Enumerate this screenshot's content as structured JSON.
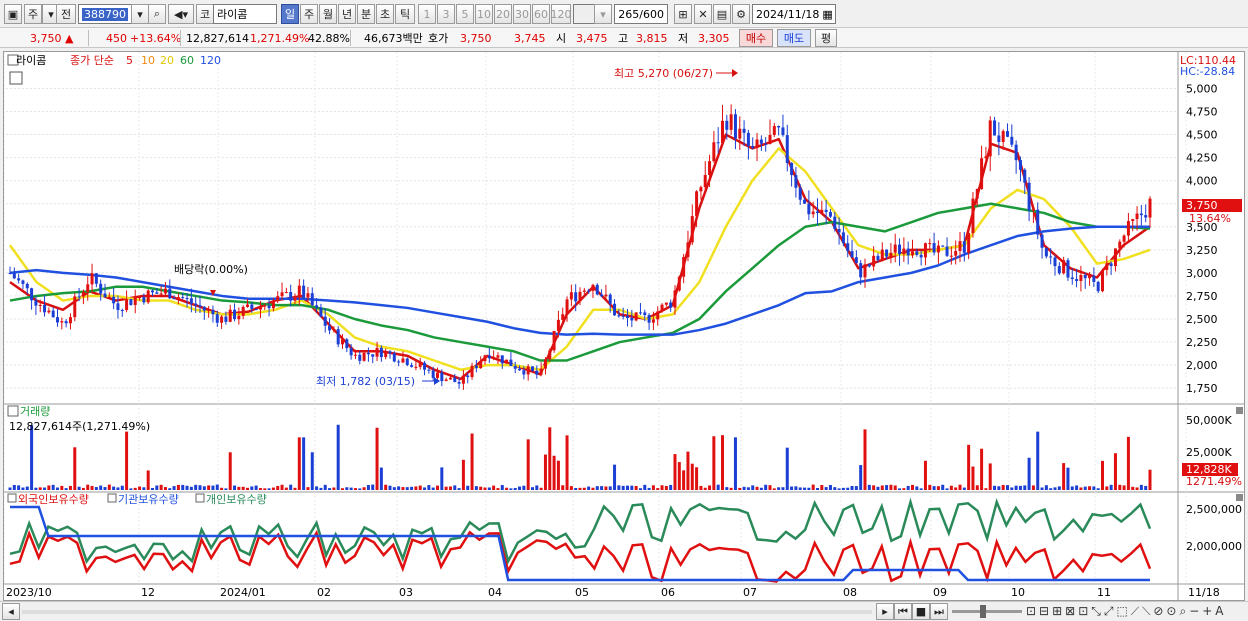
{
  "toolbar": {
    "market_label": "주",
    "prefix_label": "전",
    "code_value": "388790",
    "name_prefix": "코",
    "stock_name": "라이콤",
    "periods": [
      "일",
      "주",
      "월",
      "년",
      "분",
      "초",
      "틱"
    ],
    "selected_period": "일",
    "intervals": [
      "1",
      "3",
      "5",
      "10",
      "20",
      "30",
      "60",
      "120"
    ],
    "count_value": "265",
    "count_total": "/600",
    "date_value": "2024/11/18"
  },
  "quote": {
    "price": "3,750",
    "change_arrow": "▲",
    "change": "450",
    "change_pct": "+13.64%",
    "volume": "12,827,614",
    "volume_ratio": "1,271.49%",
    "turnover": "42.88%",
    "trade_value": "46,673백만",
    "bid_label": "호가",
    "ask_price": "3,750",
    "bid_price": "3,745",
    "open_label": "시",
    "open": "3,475",
    "high_label": "고",
    "high": "3,815",
    "low_label": "저",
    "low": "3,305",
    "buy_label": "매수",
    "sell_label": "매도",
    "eval_label": "평"
  },
  "price_panel": {
    "legend_name": "라이콤",
    "legend_ma_prefix": "종가 단순",
    "ma_periods": [
      "5",
      "10",
      "20",
      "60",
      "120"
    ],
    "ma_colors": [
      "#d81010",
      "#f08c10",
      "#f0e020",
      "#1a9a3a",
      "#2050e0"
    ],
    "lc_label": "LC:110.44",
    "hc_label": "HC:-28.84",
    "high_annotation": "최고 5,270 (06/27)",
    "low_annotation": "최저 1,782 (03/15)",
    "dividend_annotation": "배당락(0.00%)",
    "current_price_tag": "3,750",
    "current_pct_tag": "13.64%"
  },
  "volume_panel": {
    "title": "거래량",
    "value_label": "12,827,614주(1,271.49%)",
    "axis_labels": [
      "50,000K",
      "25,000K"
    ],
    "current_tag": "12,828K",
    "current_pct_tag": "1271.49%"
  },
  "holder_panel": {
    "series_labels": [
      "외국인보유수량",
      "기관보유수량",
      "개인보유수량"
    ],
    "series_colors": [
      "#e01010",
      "#2050e0",
      "#2a8a5a"
    ],
    "axis_labels": [
      "2,500,000",
      "2,000,000"
    ]
  },
  "x_axis": {
    "labels": [
      "2023/10",
      "12",
      "2024/01",
      "02",
      "03",
      "04",
      "05",
      "06",
      "07",
      "08",
      "09",
      "10",
      "11",
      "11/18"
    ]
  },
  "chart_data": {
    "type": "candlestick",
    "title": "라이콤",
    "ylim": [
      1600,
      5200
    ],
    "y_ticks": [
      1750,
      2000,
      2250,
      2500,
      2750,
      3000,
      3250,
      3500,
      3750,
      4000,
      4250,
      4500,
      4750,
      5000
    ],
    "close_path": [
      [
        "2023/10",
        3000
      ],
      [
        "2023/10",
        2700
      ],
      [
        "2023/10",
        2450
      ],
      [
        "2023/11",
        2950
      ],
      [
        "2023/11",
        2650
      ],
      [
        "2023/11",
        2750
      ],
      [
        "2023/12",
        2800
      ],
      [
        "2023/12",
        2650
      ],
      [
        "2023/12",
        2500
      ],
      [
        "2024/01",
        2600
      ],
      [
        "2024/01",
        2700
      ],
      [
        "2024/01",
        2800
      ],
      [
        "2024/02",
        2400
      ],
      [
        "2024/02",
        2100
      ],
      [
        "2024/02",
        2150
      ],
      [
        "2024/03",
        2050
      ],
      [
        "2024/03",
        1900
      ],
      [
        "2024/03",
        1800
      ],
      [
        "2024/04",
        2150
      ],
      [
        "2024/04",
        2000
      ],
      [
        "2024/04",
        1880
      ],
      [
        "2024/05",
        2700
      ],
      [
        "2024/05",
        2900
      ],
      [
        "2024/05",
        2500
      ],
      [
        "2024/06",
        2500
      ],
      [
        "2024/06",
        2700
      ],
      [
        "2024/06",
        3900
      ],
      [
        "2024/06",
        4700
      ],
      [
        "2024/07",
        4300
      ],
      [
        "2024/07",
        4500
      ],
      [
        "2024/07",
        3700
      ],
      [
        "2024/08",
        3600
      ],
      [
        "2024/08",
        3000
      ],
      [
        "2024/08",
        3200
      ],
      [
        "2024/09",
        3300
      ],
      [
        "2024/09",
        3200
      ],
      [
        "2024/09",
        3300
      ],
      [
        "2024/10",
        4600
      ],
      [
        "2024/10",
        4200
      ],
      [
        "2024/10",
        3200
      ],
      [
        "2024/10",
        3000
      ],
      [
        "2024/11",
        2850
      ],
      [
        "2024/11",
        3400
      ],
      [
        "2024/11",
        3750
      ]
    ],
    "series": [
      {
        "name": "5",
        "values": [
          2900,
          2700,
          2600,
          2800,
          2700,
          2750,
          2750,
          2650,
          2550,
          2580,
          2700,
          2750,
          2450,
          2150,
          2150,
          2100,
          1950,
          1850,
          2100,
          2000,
          1900,
          2550,
          2850,
          2550,
          2500,
          2650,
          3700,
          4500,
          4350,
          4450,
          3800,
          3550,
          3050,
          3150,
          3250,
          3250,
          3300,
          4400,
          4300,
          3300,
          3050,
          2950,
          3300,
          3500
        ]
      },
      {
        "name": "20",
        "values": [
          3300,
          2900,
          2700,
          2750,
          2750,
          2700,
          2700,
          2600,
          2550,
          2550,
          2600,
          2700,
          2550,
          2300,
          2200,
          2150,
          2050,
          1950,
          2000,
          2000,
          1950,
          2200,
          2600,
          2600,
          2500,
          2550,
          2900,
          3500,
          4000,
          4350,
          4100,
          3700,
          3300,
          3200,
          3200,
          3250,
          3300,
          3700,
          3900,
          3800,
          3500,
          3100,
          3150,
          3250
        ]
      },
      {
        "name": "60",
        "values": [
          2700,
          2750,
          2780,
          2800,
          2850,
          2850,
          2800,
          2750,
          2700,
          2680,
          2650,
          2650,
          2600,
          2500,
          2430,
          2380,
          2300,
          2250,
          2200,
          2150,
          2050,
          2050,
          2150,
          2250,
          2300,
          2350,
          2500,
          2800,
          3050,
          3300,
          3500,
          3550,
          3500,
          3450,
          3550,
          3650,
          3700,
          3750,
          3700,
          3650,
          3550,
          3500,
          3500,
          3480
        ]
      },
      {
        "name": "120",
        "values": [
          3000,
          3030,
          3000,
          2980,
          2950,
          2900,
          2850,
          2800,
          2750,
          2720,
          2720,
          2720,
          2700,
          2680,
          2650,
          2620,
          2570,
          2520,
          2470,
          2400,
          2350,
          2330,
          2340,
          2330,
          2330,
          2330,
          2380,
          2450,
          2550,
          2650,
          2780,
          2800,
          2900,
          2950,
          3000,
          3080,
          3200,
          3300,
          3400,
          3450,
          3480,
          3500,
          3500,
          3500
        ]
      }
    ]
  }
}
